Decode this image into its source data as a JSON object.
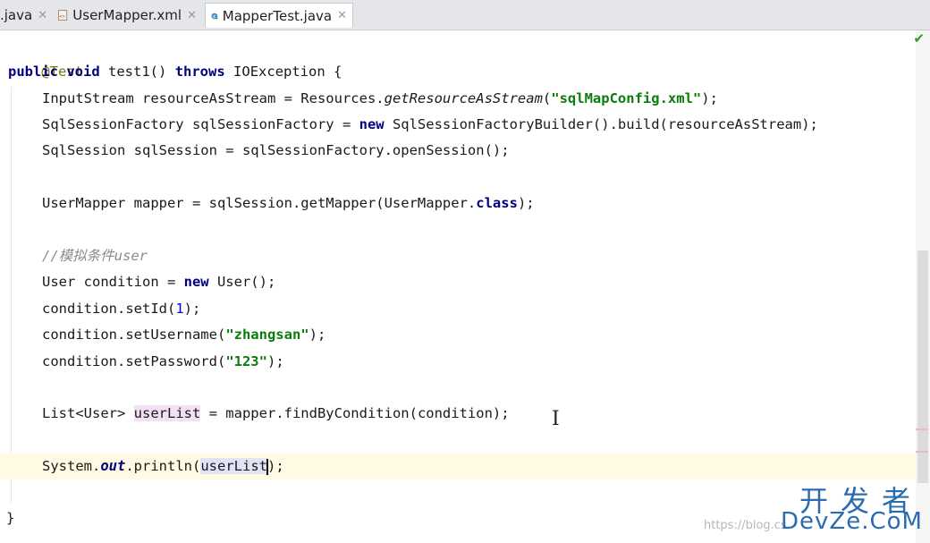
{
  "tabs": [
    {
      "label": ".java",
      "close": "✕",
      "icon": "java-file-icon"
    },
    {
      "label": "UserMapper.xml",
      "close": "✕",
      "icon": "xml-file-icon"
    },
    {
      "label": "MapperTest.java",
      "close": "✕",
      "icon": "class-file-icon",
      "active": true
    }
  ],
  "code": {
    "l1": "@Test",
    "l2_kw1": "public",
    "l2_kw2": "void",
    "l2_name": "test1()",
    "l2_kw3": "throws",
    "l2_rest": "IOException {",
    "l3_a": "InputStream resourceAsStream = Resources.",
    "l3_m": "getResourceAsStream",
    "l3_p1": "(",
    "l3_s": "\"sqlMapConfig.xml\"",
    "l3_p2": ");",
    "l4_a": "SqlSessionFactory sqlSessionFactory = ",
    "l4_kw": "new",
    "l4_b": " SqlSessionFactoryBuilder().build(resourceAsStream);",
    "l5": "SqlSession sqlSession = sqlSessionFactory.openSession();",
    "l6_a": "UserMapper mapper = sqlSession.getMapper(UserMapper.",
    "l6_kw": "class",
    "l6_b": ");",
    "l7": "//模拟条件user",
    "l8_a": "User condition = ",
    "l8_kw": "new",
    "l8_b": " User();",
    "l9_a": "condition.setId(",
    "l9_n": "1",
    "l9_b": ");",
    "l10_a": "condition.setUsername(",
    "l10_s": "\"zhangsan\"",
    "l10_b": ");",
    "l11_a": "condition.setPassword(",
    "l11_s": "\"123\"",
    "l11_b": ");",
    "l12_a": "List<User> ",
    "l12_v": "userList",
    "l12_b": " = mapper.findByCondition(condition);",
    "l13_a": "System.",
    "l13_f": "out",
    "l13_b": ".println(",
    "l13_v": "userList",
    "l13_c": ");",
    "l14": "}"
  },
  "watermark": {
    "url": "https://blog.cs",
    "cn": "开发者",
    "en": "DevZe.CoM"
  }
}
